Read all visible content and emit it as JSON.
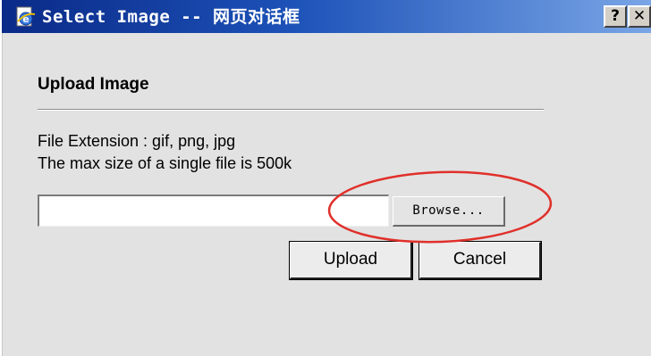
{
  "window": {
    "title": "Select Image -- 网页对话框",
    "help_label": "?",
    "close_label": "✕"
  },
  "icons": {
    "title": "ie-page-icon",
    "help": "help-icon",
    "close": "close-icon"
  },
  "colors": {
    "titlebar_start": "#0a2a88",
    "titlebar_end": "#7aa6e6",
    "dialog_bg": "#e2e2e2",
    "highlight_ellipse": "#e0302a"
  },
  "form": {
    "heading": "Upload Image",
    "info_extension": "File Extension : gif, png, jpg",
    "info_max_size": "The max size of a single file is 500k",
    "file_value": "",
    "browse_label": "Browse...",
    "upload_label": "Upload",
    "cancel_label": "Cancel"
  }
}
